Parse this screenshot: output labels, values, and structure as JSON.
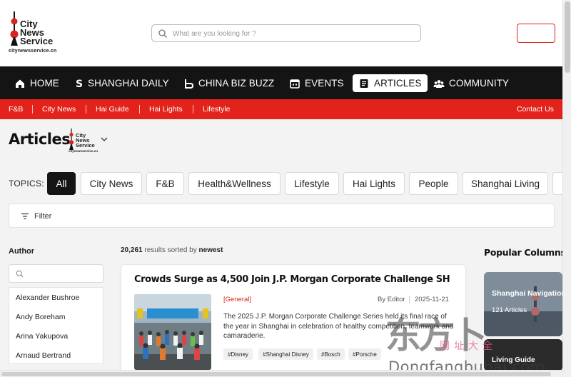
{
  "header": {
    "logo_lines": [
      "City",
      "News",
      "Service"
    ],
    "logo_domain": "citynewsservice.cn",
    "search_placeholder": "What are you looking for ?"
  },
  "mainnav": [
    {
      "label": "HOME",
      "icon": "home-icon"
    },
    {
      "label": "SHANGHAI DAILY",
      "icon": "shanghai-daily-icon"
    },
    {
      "label": "CHINA BIZ BUZZ",
      "icon": "biz-buzz-icon"
    },
    {
      "label": "EVENTS",
      "icon": "calendar-icon"
    },
    {
      "label": "ARTICLES",
      "icon": "article-icon",
      "active": true
    },
    {
      "label": "COMMUNITY",
      "icon": "community-icon"
    }
  ],
  "subnav": {
    "items": [
      "F&B",
      "City News",
      "Hai Guide",
      "Hai Lights",
      "Lifestyle"
    ],
    "contact": "Contact Us"
  },
  "page": {
    "title": "Articles",
    "small_logo_lines": [
      "City",
      "News",
      "Service"
    ],
    "small_logo_domain": "citynewsservice.cn"
  },
  "topics": {
    "label": "TOPICS:",
    "items": [
      "All",
      "City News",
      "F&B",
      "Health&Wellness",
      "Lifestyle",
      "Hai Lights",
      "People",
      "Shanghai Living"
    ],
    "selected": "All"
  },
  "filter": {
    "label": "Filter"
  },
  "sidebar": {
    "title": "Author",
    "authors": [
      "Alexander Bushroe",
      "Andy Boreham",
      "Arina Yakupova",
      "Arnaud Bertrand"
    ]
  },
  "results": {
    "count": "20,261",
    "text": "results sorted by",
    "sort": "newest"
  },
  "article": {
    "title": "Crowds Surge as 4,500 Join J.P. Morgan Corporate Challenge SH",
    "category": "[General]",
    "author": "By Editor",
    "date": "2025-11-21",
    "description": "The 2025 J.P. Morgan Corporate Challenge Series held its final race of the year in Shanghai in celebration of healthy competition, teamwork and camaraderie.",
    "tags": [
      "#Disney",
      "#Shanghai Disney",
      "#Bosch",
      "#Porsche"
    ]
  },
  "popular": {
    "title": "Popular Columns",
    "columns": [
      {
        "name": "Shanghai Navigation",
        "count": "121 Articles"
      },
      {
        "name": "Living Guide"
      }
    ]
  },
  "watermark": {
    "big": "东方卜",
    "mid": "网址大全",
    "url": "Dongfangbubai.com"
  },
  "colors": {
    "accent": "#e3231b",
    "nav_bg": "#141414"
  }
}
